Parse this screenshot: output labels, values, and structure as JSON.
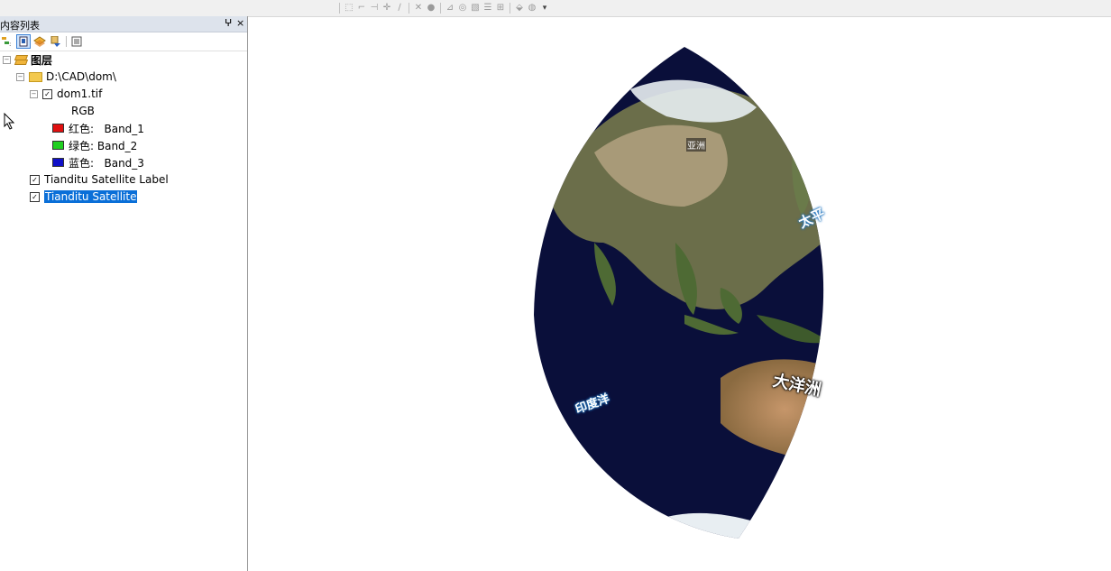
{
  "toc": {
    "title": "内容列表",
    "pin_glyph": "ⵖ",
    "close_glyph": "×",
    "root": {
      "label": "图层"
    },
    "folder": {
      "label": "D:\\CAD\\dom\\"
    },
    "raster": {
      "label": "dom1.tif",
      "composite": "RGB",
      "bands": [
        {
          "label": "红色:   Band_1",
          "color": "#e01010"
        },
        {
          "label": "绿色: Band_2",
          "color": "#20d020"
        },
        {
          "label": "蓝色:   Band_3",
          "color": "#1010c8"
        }
      ]
    },
    "layers": [
      {
        "label": "Tianditu Satellite Label",
        "checked": true,
        "selected": false
      },
      {
        "label": "Tianditu Satellite",
        "checked": true,
        "selected": true
      }
    ]
  },
  "map": {
    "labels": {
      "asia": "亚洲",
      "pacific": "太平",
      "indian": "印度洋",
      "oceania": "大洋洲"
    },
    "colors": {
      "ocean": "#0a0f3a",
      "land": "#5a6b3a",
      "desert": "#b88a5a",
      "snow": "#e8eef2"
    }
  },
  "icons": {
    "check": "✓",
    "collapse": "−"
  }
}
